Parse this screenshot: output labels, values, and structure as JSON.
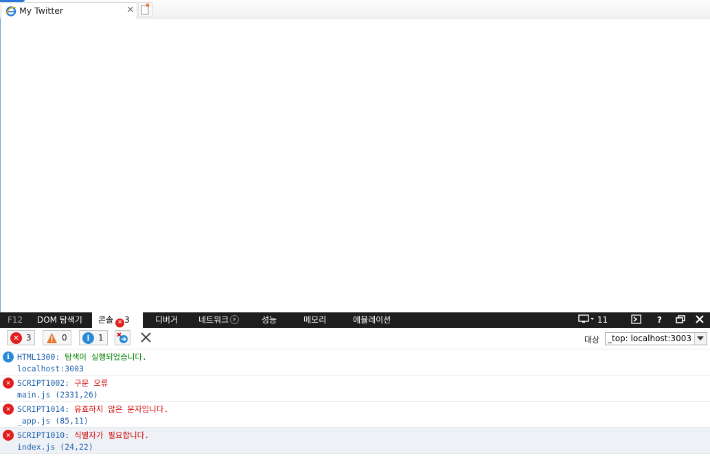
{
  "browser": {
    "tab_title": "My Twitter",
    "tab_close": "×",
    "icons": {
      "tab_icon": "ie-logo-icon",
      "new_tab": "new-tab-icon"
    }
  },
  "devtools": {
    "f12_label": "F12",
    "tabs": [
      {
        "label": "DOM 탐색기"
      },
      {
        "label": "콘솔",
        "error_badge": "3"
      },
      {
        "label": "디버거"
      },
      {
        "label": "네트워크"
      },
      {
        "label": "성능"
      },
      {
        "label": "메모리"
      },
      {
        "label": "에뮬레이션"
      }
    ],
    "right_controls": {
      "version": "11",
      "help": "?",
      "icons": [
        "monitor-icon",
        "console-prompt-icon",
        "help-icon",
        "restore-icon",
        "close-icon"
      ]
    },
    "toolbar": {
      "errors_count": "3",
      "warnings_count": "0",
      "info_count": "1",
      "target_label": "대상",
      "target_value": "_top: localhost:3003"
    },
    "messages": [
      {
        "type": "info",
        "code": "HTML1300",
        "sep": ": ",
        "text": "탐색이 실행되었습니다.",
        "source": "localhost:3003"
      },
      {
        "type": "error",
        "code": "SCRIPT1002",
        "sep": ": ",
        "text": "구문 오류",
        "source": "main.js (2331,26)"
      },
      {
        "type": "error",
        "code": "SCRIPT1014",
        "sep": ": ",
        "text": "유효하지 않은 문자입니다.",
        "source": "_app.js (85,11)"
      },
      {
        "type": "error",
        "code": "SCRIPT1010",
        "sep": ": ",
        "text": "식별자가 필요합니다.",
        "source": "index.js (24,22)"
      }
    ]
  },
  "colors": {
    "devtools_bar": "#1e1e1e",
    "error": "#e21c1c",
    "info": "#2a8ad8",
    "warning": "#e8762b",
    "link": "#1c5fab"
  }
}
